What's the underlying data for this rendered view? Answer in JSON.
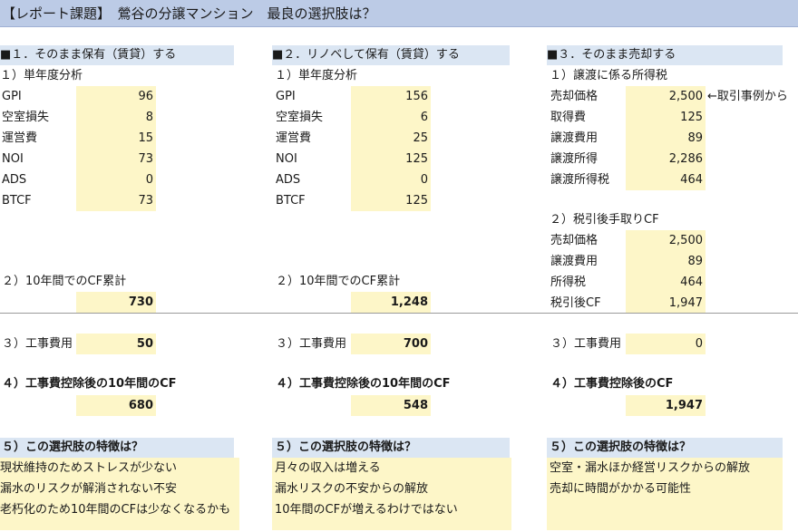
{
  "title": "【レポート課題】　鶯谷の分譲マンション　最良の選択肢は？",
  "col1": {
    "header": "■１．そのまま保有（賃貸）する",
    "sub1": "１）単年度分析",
    "rows": [
      {
        "label": "GPI",
        "value": "96"
      },
      {
        "label": "空室損失",
        "value": "8"
      },
      {
        "label": "運営費",
        "value": "15"
      },
      {
        "label": "NOI",
        "value": "73"
      },
      {
        "label": "ADS",
        "value": "0"
      },
      {
        "label": "BTCF",
        "value": "73"
      }
    ],
    "sub2": "２）10年間でのCF累計",
    "cf_total": "730",
    "sub3": "３）工事費用",
    "construction": "50",
    "sub4": "４）工事費控除後の10年間のCF",
    "cf_after": "680",
    "feature_header": "５）この選択肢の特徴は？",
    "features": [
      "現状維持のためストレスが少ない",
      "漏水のリスクが解消されない不安",
      "老朽化のため10年間のCFは少なくなるかも"
    ]
  },
  "col2": {
    "header": "■２．リノベして保有（賃貸）する",
    "sub1": "１）単年度分析",
    "rows": [
      {
        "label": "GPI",
        "value": "156"
      },
      {
        "label": "空室損失",
        "value": "6"
      },
      {
        "label": "運営費",
        "value": "25"
      },
      {
        "label": "NOI",
        "value": "125"
      },
      {
        "label": "ADS",
        "value": "0"
      },
      {
        "label": "BTCF",
        "value": "125"
      }
    ],
    "sub2": "２）10年間でのCF累計",
    "cf_total": "1,248",
    "sub3": "３）工事費用",
    "construction": "700",
    "sub4": "４）工事費控除後の10年間のCF",
    "cf_after": "548",
    "feature_header": "５）この選択肢の特徴は？",
    "features": [
      "月々の収入は増える",
      "漏水リスクの不安からの解放",
      "10年間のCFが増えるわけではない"
    ]
  },
  "col3": {
    "header": "■３．そのまま売却する",
    "sub1": "１）譲渡に係る所得税",
    "rows": [
      {
        "label": "売却価格",
        "value": "2,500"
      },
      {
        "label": "取得費",
        "value": "125"
      },
      {
        "label": "譲渡費用",
        "value": "89"
      },
      {
        "label": "譲渡所得",
        "value": "2,286"
      },
      {
        "label": "譲渡所得税",
        "value": "464"
      }
    ],
    "note": "←取引事例から",
    "sub2": "２）税引後手取りCF",
    "rows2": [
      {
        "label": "売却価格",
        "value": "2,500"
      },
      {
        "label": "譲渡費用",
        "value": "89"
      },
      {
        "label": "所得税",
        "value": "464"
      },
      {
        "label": "税引後CF",
        "value": "1,947"
      }
    ],
    "sub3": "３）工事費用",
    "construction": "0",
    "sub4": "４）工事費控除後のCF",
    "cf_after": "1,947",
    "feature_header": "５）この選択肢の特徴は？",
    "features": [
      "空室・漏水ほか経営リスクからの解放",
      "売却に時間がかかる可能性"
    ]
  }
}
